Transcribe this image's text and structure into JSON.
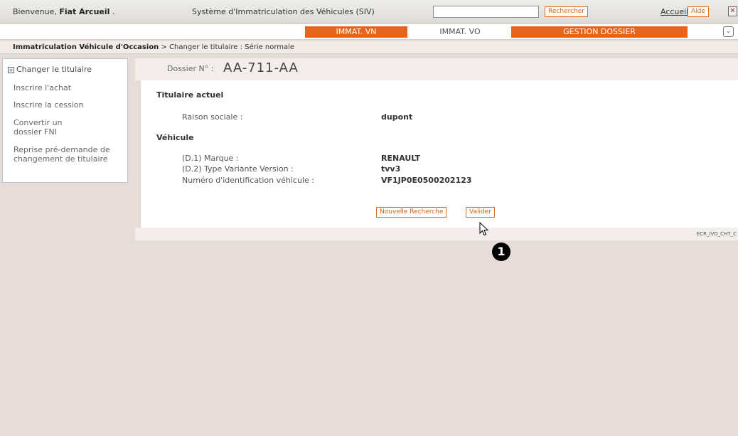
{
  "header": {
    "welcome_prefix": "Bienvenue,",
    "user_name": "Fiat Arcueil",
    "welcome_suffix": ".",
    "system_title": "Système d'Immatriculation des Véhicules (SIV)",
    "search_placeholder": "",
    "search_button": "Rechercher",
    "home_link": "Accueil",
    "help_button": "Aide",
    "close_icon": "close-icon"
  },
  "tabs": [
    {
      "label": "IMMAT. VN",
      "active": false
    },
    {
      "label": "IMMAT. VO",
      "active": true
    },
    {
      "label": "GESTION DOSSIER",
      "active": false
    }
  ],
  "breadcrumb": {
    "root": "Immatriculation Véhicule d'Occasion",
    "separator": ">",
    "path": "Changer le titulaire : Série normale"
  },
  "sidebar": {
    "items": [
      {
        "label": "Changer le titulaire"
      },
      {
        "label": "Inscrire l'achat"
      },
      {
        "label": "Inscrire la cession"
      },
      {
        "label": "Convertir un dossier FNI"
      },
      {
        "label": "Reprise pré-demande de changement de titulaire"
      }
    ]
  },
  "dossier": {
    "label": "Dossier N° :",
    "number": "AA-711-AA"
  },
  "titulaire": {
    "section_title": "Titulaire actuel",
    "raison_sociale_label": "Raison sociale :",
    "raison_sociale_value": "dupont"
  },
  "vehicule": {
    "section_title": "Véhicule",
    "marque_label": "(D.1) Marque :",
    "marque_value": "RENAULT",
    "tvv_label": "(D.2) Type Variante Version :",
    "tvv_value": "tvv3",
    "vin_label": "Numéro d'identification véhicule :",
    "vin_value": "VF1JP0E0500202123"
  },
  "actions": {
    "new_search": "Nouvelle Recherche",
    "validate": "Valider"
  },
  "footer": {
    "screen_code": "ECR_IVO_CHT_C"
  },
  "annotation": {
    "marker": "1"
  },
  "colors": {
    "accent_orange": "#e5651d",
    "background": "#e6ddd8"
  }
}
